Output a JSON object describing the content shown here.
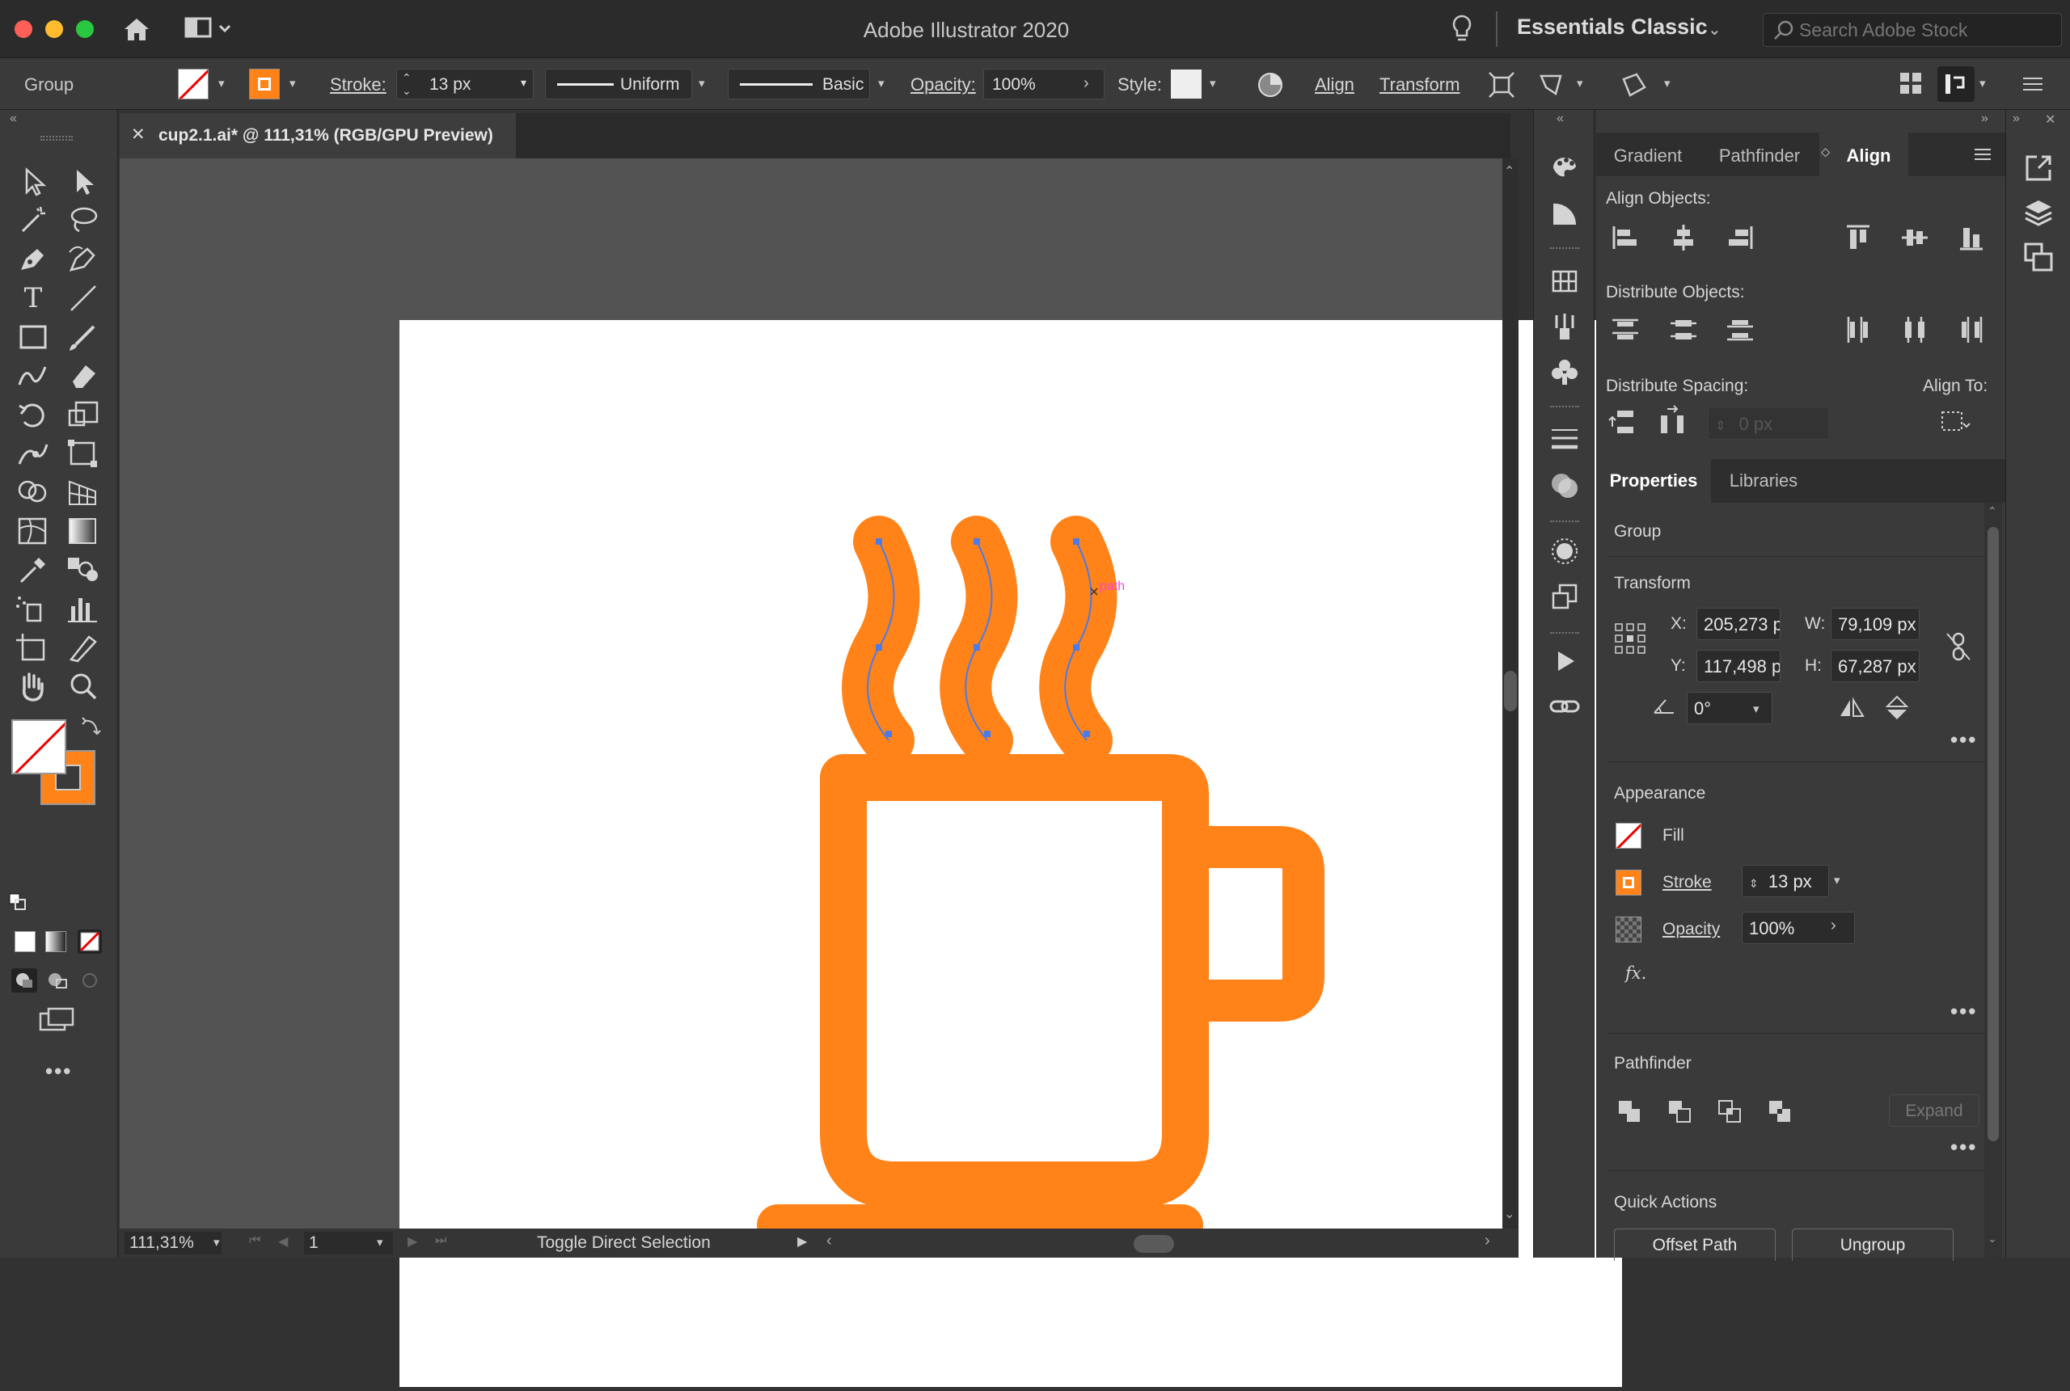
{
  "app": {
    "title": "Adobe Illustrator 2020",
    "workspace": "Essentials Classic",
    "search_placeholder": "Search Adobe Stock"
  },
  "control_bar": {
    "selection_type": "Group",
    "stroke_label": "Stroke:",
    "stroke_value": "13 px",
    "profile": "Uniform",
    "brush": "Basic",
    "opacity_label": "Opacity:",
    "opacity_value": "100%",
    "style_label": "Style:",
    "align_label": "Align",
    "transform_label": "Transform"
  },
  "document": {
    "tab_title": "cup2.1.ai* @ 111,31% (RGB/GPU Preview)",
    "close_glyph": "✕",
    "hover_label": "path"
  },
  "status_bar": {
    "zoom": "111,31%",
    "artboard": "1",
    "tool_hint": "Toggle Direct Selection"
  },
  "align_panel": {
    "tabs": [
      "Gradient",
      "Pathfinder",
      "Align"
    ],
    "active_tab": "Align",
    "align_objects_label": "Align Objects:",
    "distribute_objects_label": "Distribute Objects:",
    "distribute_spacing_label": "Distribute Spacing:",
    "align_to_label": "Align To:",
    "spacing_value": "0 px"
  },
  "properties_panel": {
    "tabs": [
      "Properties",
      "Libraries"
    ],
    "active_tab": "Properties",
    "object_type": "Group",
    "transform_title": "Transform",
    "x_label": "X:",
    "x_value": "205,273 p",
    "y_label": "Y:",
    "y_value": "117,498 p",
    "w_label": "W:",
    "w_value": "79,109 px",
    "h_label": "H:",
    "h_value": "67,287 px",
    "angle_value": "0°",
    "appearance_title": "Appearance",
    "fill_label": "Fill",
    "stroke_label": "Stroke",
    "stroke_value": "13 px",
    "opacity_label": "Opacity",
    "opacity_value": "100%",
    "fx_label": "fx.",
    "pathfinder_title": "Pathfinder",
    "expand_label": "Expand",
    "quick_actions_title": "Quick Actions",
    "offset_path_label": "Offset Path",
    "ungroup_label": "Ungroup"
  },
  "colors": {
    "accent_orange": "#FF8319",
    "selection_blue": "#4A7BE8",
    "ui_bg": "#3A3A3A",
    "artboard": "#FFFFFF"
  },
  "icons": {
    "tools": [
      "selection-tool-icon",
      "direct-selection-tool-icon",
      "magic-wand-icon",
      "lasso-icon",
      "pen-icon",
      "curvature-icon",
      "type-icon",
      "line-icon",
      "rectangle-icon",
      "paintbrush-icon",
      "shaper-icon",
      "eraser-icon",
      "rotate-icon",
      "scale-icon",
      "warp-icon",
      "free-transform-icon",
      "shape-builder-icon",
      "perspective-grid-icon",
      "mesh-icon",
      "gradient-icon",
      "eyedropper-icon",
      "blend-icon",
      "symbol-sprayer-icon",
      "graph-icon",
      "artboard-icon",
      "slice-icon",
      "hand-icon",
      "zoom-icon"
    ]
  }
}
